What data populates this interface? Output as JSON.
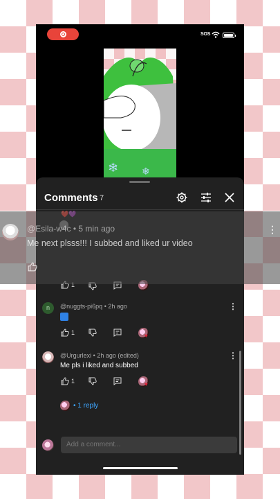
{
  "status": {
    "sos": "SOS"
  },
  "sheet": {
    "title": "Comments",
    "count": "7"
  },
  "comments": [
    {
      "user": "@nuggts-pi6pq",
      "time": "2h ago",
      "text": "🟦",
      "likes": "1",
      "avatar_letter": "n",
      "avatar_color": "#2e5b2e"
    },
    {
      "user": "@Urgurlexi",
      "time": "2h ago (edited)",
      "text": "Me pls i liked and subbed",
      "likes": "1",
      "reply_count": "1 reply"
    }
  ],
  "partial_comment": {
    "likes": "1",
    "emojis": "❤️💜"
  },
  "overlay": {
    "user": "@Esila-w4c",
    "time": "5 min ago",
    "text": "Me next plsss!!! I subbed and liked ur video"
  },
  "composer": {
    "placeholder": "Add a comment..."
  },
  "colors": {
    "accent": "#3ea6ff",
    "record": "#e8443a",
    "sheet_bg": "#212121"
  }
}
